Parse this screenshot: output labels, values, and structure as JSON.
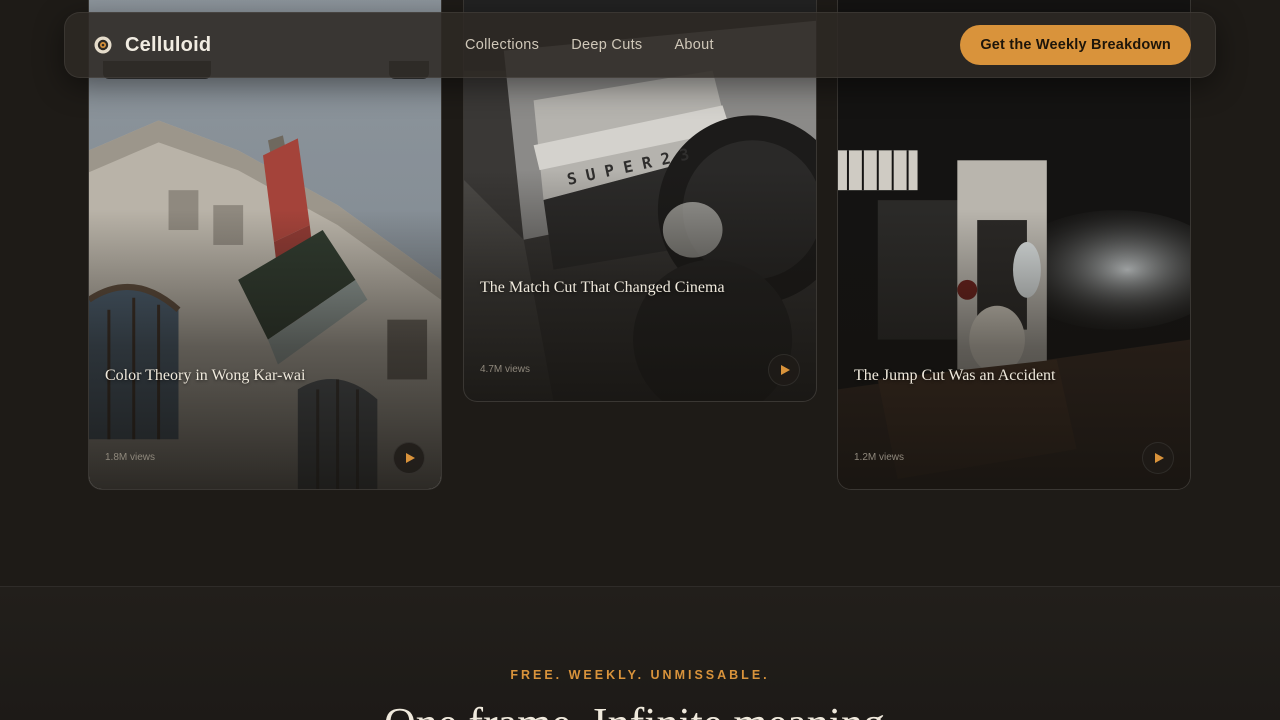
{
  "nav": {
    "brand": "Celluloid",
    "links": [
      "Collections",
      "Deep Cuts",
      "About"
    ],
    "cta": "Get the Weekly Breakdown"
  },
  "cards": [
    {
      "title": "Color Theory in Wong Kar-wai",
      "views": "1.8M views"
    },
    {
      "title": "The Match Cut That Changed Cinema",
      "views": "4.7M views"
    },
    {
      "title": "The Jump Cut Was an Accident",
      "views": "1.2M views"
    }
  ],
  "newsletter": {
    "eyebrow": "FREE. WEEKLY. UNMISSABLE.",
    "headline": "One frame. Infinite meaning."
  },
  "colors": {
    "background": "#1e1b17",
    "accent": "#d9933b",
    "nav_bg": "#2d2924",
    "text": "#efe9dc"
  }
}
